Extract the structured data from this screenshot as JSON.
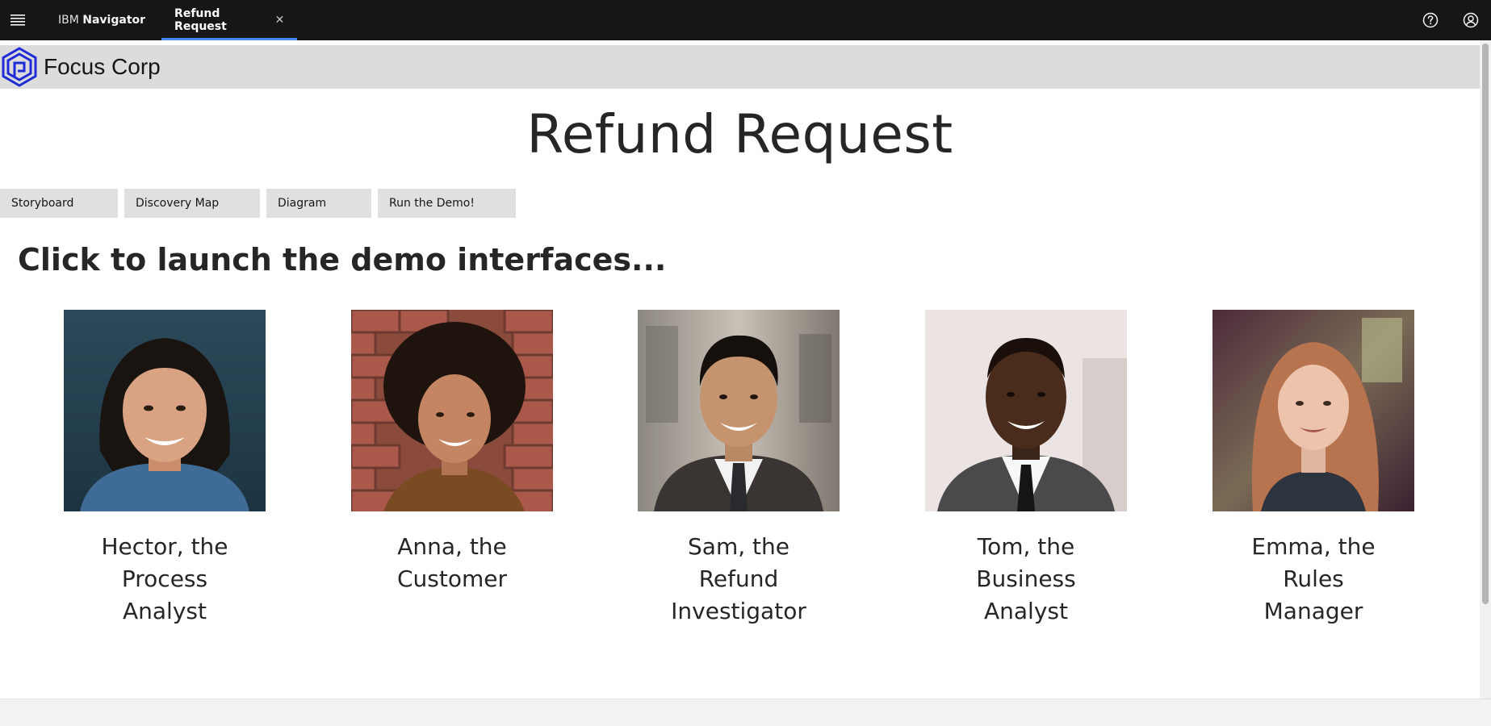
{
  "topbar": {
    "app_name_prefix": "IBM",
    "app_name_bold": "Navigator",
    "active_tab": "Refund Request",
    "close_glyph": "✕",
    "icons": [
      "menu-icon",
      "help-icon",
      "user-avatar-icon"
    ]
  },
  "brand": {
    "name": "Focus Corp"
  },
  "page": {
    "title": "Refund Request",
    "heading": "Click to launch the demo interfaces..."
  },
  "buttons": [
    {
      "label": "Storyboard"
    },
    {
      "label": "Discovery Map"
    },
    {
      "label": "Diagram"
    },
    {
      "label": "Run the Demo!"
    }
  ],
  "personas": [
    {
      "lines": [
        "Hector, the",
        "Process",
        "Analyst"
      ]
    },
    {
      "lines": [
        "Anna, the",
        "Customer"
      ]
    },
    {
      "lines": [
        "Sam, the",
        "Refund",
        "Investigator"
      ]
    },
    {
      "lines": [
        "Tom, the",
        "Business",
        "Analyst"
      ]
    },
    {
      "lines": [
        "Emma, the",
        "Rules",
        "Manager"
      ]
    }
  ],
  "colors": {
    "topbar_bg": "#161616",
    "active_tab_underline": "#4589ff",
    "brand_header_bg": "#dcdcdc",
    "button_bg": "#e0e0e0",
    "logo_blue": "#1f2bd6"
  }
}
